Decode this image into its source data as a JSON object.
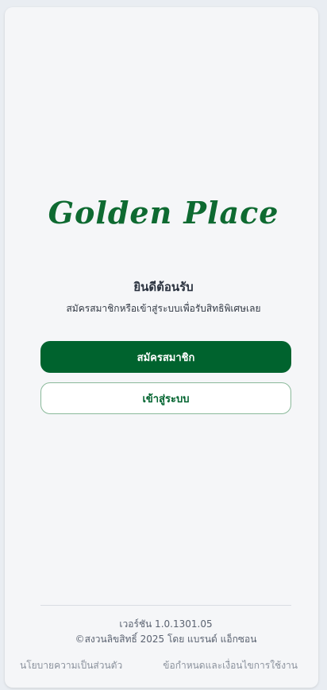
{
  "brand": {
    "logo_text": "Golden Place",
    "color": "#0e6a31"
  },
  "welcome": {
    "title": "ยินดีต้อนรับ",
    "subtitle": "สมัครสมาชิกหรือเข้าสู่ระบบเพื่อรับสิทธิพิเศษเลย"
  },
  "actions": {
    "register_label": "สมัครสมาชิก",
    "login_label": "เข้าสู่ระบบ",
    "primary_color": "#00632e"
  },
  "footer": {
    "version": "เวอร์ชัน 1.0.1301.05",
    "copyright": "©สงวนลิขสิทธิ์ 2025 โดย แบรนด์ แอ็กซอน",
    "privacy_link": "นโยบายความเป็นส่วนตัว",
    "terms_link": "ข้อกำหนดและเงื่อนไขการใช้งาน"
  }
}
